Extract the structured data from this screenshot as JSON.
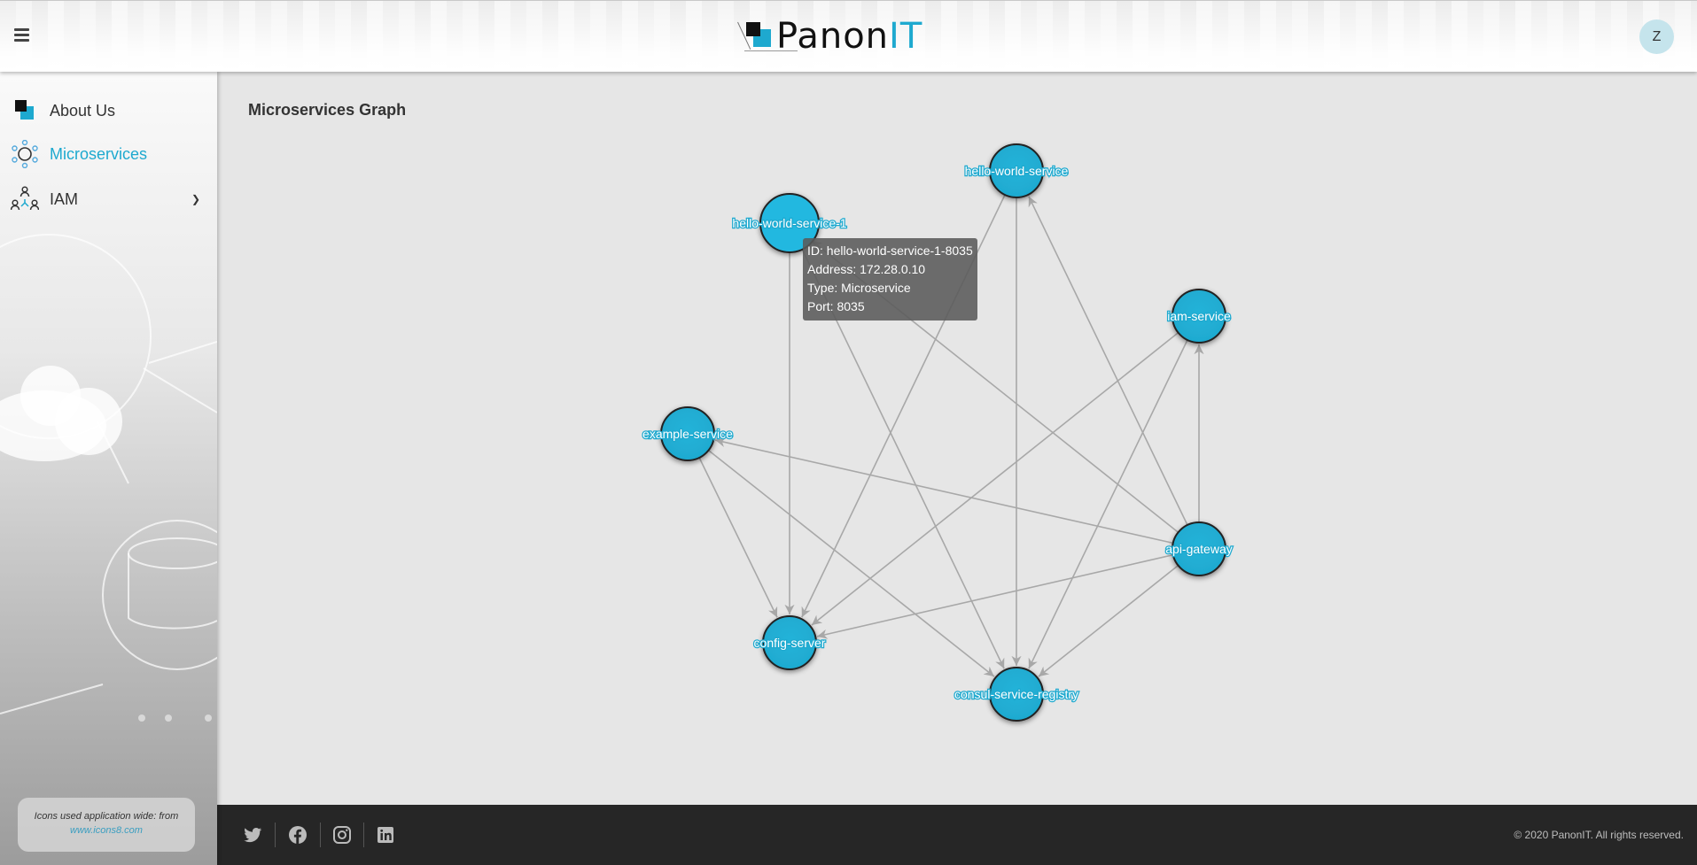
{
  "header": {
    "menu_icon": "hamburger-icon",
    "logo_text_main": "Panon",
    "logo_text_accent": "IT",
    "avatar_initial": "Z"
  },
  "sidebar": {
    "items": [
      {
        "label": "About Us",
        "icon": "about-us-icon",
        "active": false
      },
      {
        "label": "Microservices",
        "icon": "microservices-icon",
        "active": true
      },
      {
        "label": "IAM",
        "icon": "iam-icon",
        "active": false,
        "expandable": true
      }
    ],
    "credit_text": "Icons used application wide: from",
    "credit_link": "www.icons8.com"
  },
  "main": {
    "title": "Microservices Graph",
    "graph": {
      "nodes": [
        {
          "id": "hello-world-service-1",
          "label": "hello-world-service-1",
          "hovered": true
        },
        {
          "id": "hello-world-service",
          "label": "hello-world-service"
        },
        {
          "id": "iam-service",
          "label": "iam-service"
        },
        {
          "id": "example-service",
          "label": "example-service"
        },
        {
          "id": "api-gateway",
          "label": "api-gateway"
        },
        {
          "id": "config-server",
          "label": "config-server"
        },
        {
          "id": "consul-service-registry",
          "label": "consul-service-registry"
        }
      ],
      "edges": [
        {
          "source": "hello-world-service-1",
          "target": "config-server"
        },
        {
          "source": "hello-world-service-1",
          "target": "consul-service-registry"
        },
        {
          "source": "api-gateway",
          "target": "hello-world-service-1"
        },
        {
          "source": "hello-world-service",
          "target": "config-server"
        },
        {
          "source": "hello-world-service",
          "target": "consul-service-registry"
        },
        {
          "source": "api-gateway",
          "target": "hello-world-service"
        },
        {
          "source": "api-gateway",
          "target": "iam-service"
        },
        {
          "source": "api-gateway",
          "target": "example-service"
        },
        {
          "source": "api-gateway",
          "target": "config-server"
        },
        {
          "source": "api-gateway",
          "target": "consul-service-registry"
        },
        {
          "source": "iam-service",
          "target": "config-server"
        },
        {
          "source": "iam-service",
          "target": "consul-service-registry"
        },
        {
          "source": "example-service",
          "target": "config-server"
        },
        {
          "source": "example-service",
          "target": "consul-service-registry"
        }
      ],
      "node_color": "#1ea9cf",
      "edge_color": "#a8a8a8"
    },
    "tooltip": {
      "id_line": "ID: hello-world-service-1-8035",
      "address_line": "Address: 172.28.0.10",
      "type_line": "Type: Microservice",
      "port_line": "Port: 8035"
    }
  },
  "footer": {
    "social": [
      "twitter-icon",
      "facebook-icon",
      "instagram-icon",
      "linkedin-icon"
    ],
    "copyright": "© 2020 PanonIT. All rights reserved."
  }
}
